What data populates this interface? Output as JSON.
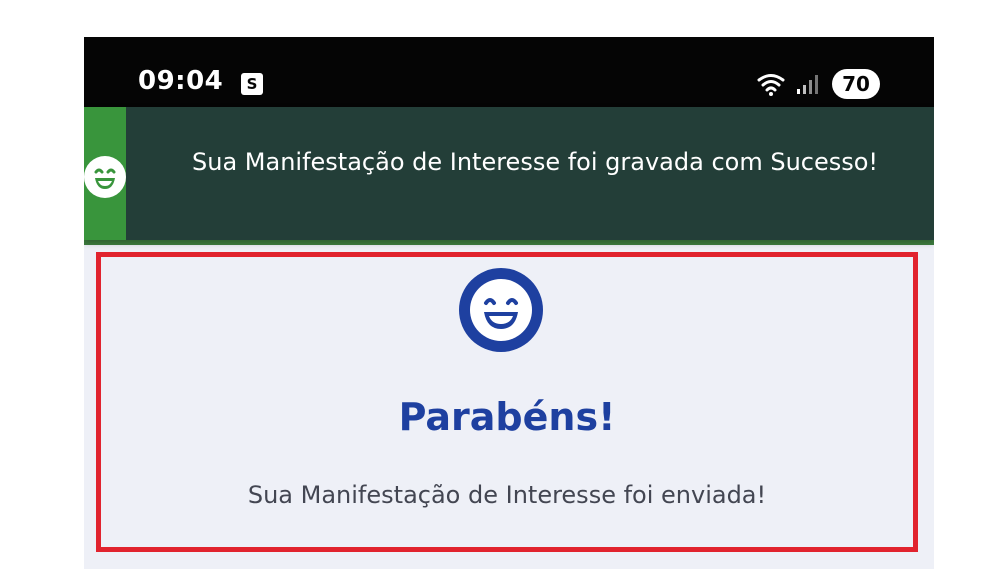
{
  "status_bar": {
    "time": "09:04",
    "notification_icon": "S",
    "battery_level": "70",
    "icons": [
      "app-notification-icon",
      "wifi-icon",
      "signal-icon",
      "battery-icon"
    ]
  },
  "toast": {
    "message": "Sua Manifestação de Interesse foi gravada com Sucesso!",
    "icon": "smile-icon",
    "accent_color": "#39953c",
    "background_color": "#233e38"
  },
  "card": {
    "title": "Parabéns!",
    "message": "Sua Manifestação de Interesse foi enviada!",
    "icon": "smile-icon",
    "title_color": "#1e40a0",
    "border_color": "#e1232e"
  }
}
